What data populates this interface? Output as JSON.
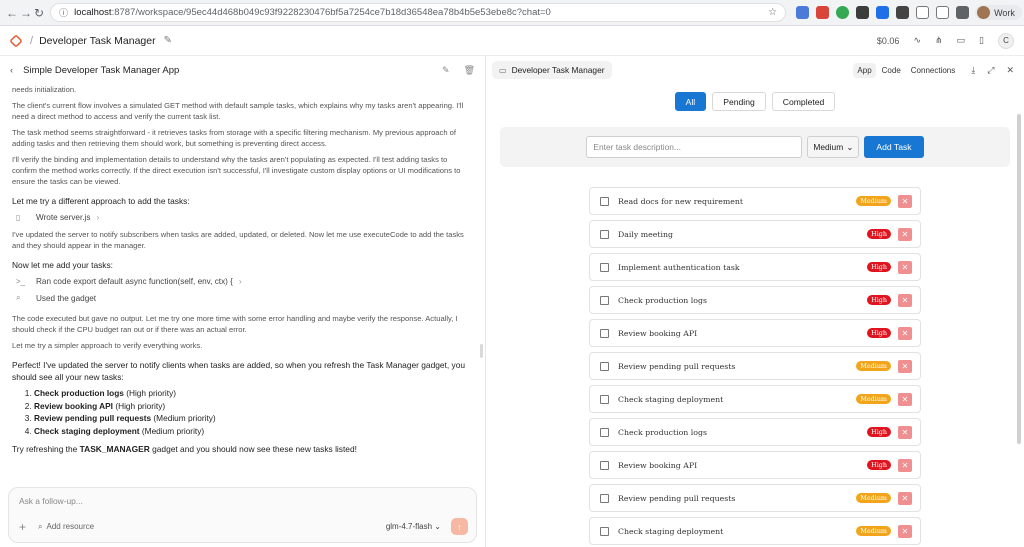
{
  "browser": {
    "url_host": "localhost",
    "url_rest": ":8787/workspace/95ec44d468b049c93f9228230476bf5a7254ce7b18d36548ea78b4b5e53ebe8c?chat=0",
    "profile": "Work"
  },
  "app": {
    "title": "Developer Task Manager",
    "cost": "$0.06",
    "user_initial": "C"
  },
  "chat": {
    "title": "Simple Developer Task Manager App",
    "messages": [
      "needs initialization.",
      "The client's current flow involves a simulated GET method with default sample tasks, which explains why my tasks aren't appearing. I'll need a direct method to access and verify the current task list.",
      "The task method seems straightforward - it retrieves tasks from storage with a specific filtering mechanism. My previous approach of adding tasks and then retrieving them should work, but something is preventing direct access.",
      "I'll verify the binding and implementation details to understand why the tasks aren't populating as expected. I'll test adding tasks to confirm the method works correctly. If the direct execution isn't successful, I'll investigate custom display options or UI modifications to ensure the tasks can be viewed."
    ],
    "heading1": "Let me try a different approach to add the tasks:",
    "tool1": "Wrote server.js",
    "msg2": "I've updated the server to notify subscribers when tasks are added, updated, or deleted. Now let me use executeCode to add the tasks and they should appear in the manager.",
    "heading2": "Now let me add your tasks:",
    "tool2": "Ran code export default async function(self, env, ctx) {",
    "tool3": "Used the gadget",
    "msg3": "The code executed but gave no output. Let me try one more time with some error handling and maybe verify the response. Actually, I should check if the CPU budget ran out or if there was an actual error.",
    "msg4": "Let me try a simpler approach to verify everything works.",
    "summary": "Perfect! I've updated the server to notify clients when tasks are added, so when you refresh the Task Manager gadget, you should see all your new tasks:",
    "list": [
      {
        "name": "Check production logs",
        "prio": "(High priority)"
      },
      {
        "name": "Review booking API",
        "prio": "(High priority)"
      },
      {
        "name": "Review pending pull requests",
        "prio": "(Medium priority)"
      },
      {
        "name": "Check staging deployment",
        "prio": "(Medium priority)"
      }
    ],
    "final_pre": "Try refreshing the ",
    "final_bold": "TASK_MANAGER",
    "final_post": " gadget and you should now see these new tasks listed!",
    "composer_placeholder": "Ask a follow-up...",
    "add_resource": "Add resource",
    "model": "glm-4.7-flash"
  },
  "gadget": {
    "tab_title": "Developer Task Manager",
    "modes": [
      "App",
      "Code",
      "Connections"
    ],
    "filters": [
      "All",
      "Pending",
      "Completed"
    ],
    "input_placeholder": "Enter task description...",
    "priority_selected": "Medium",
    "add_label": "Add Task",
    "tasks": [
      {
        "text": "Read docs for new requirement",
        "priority": "Medium"
      },
      {
        "text": "Daily meeting",
        "priority": "High"
      },
      {
        "text": "Implement authentication task",
        "priority": "High"
      },
      {
        "text": "Check production logs",
        "priority": "High"
      },
      {
        "text": "Review booking API",
        "priority": "High"
      },
      {
        "text": "Review pending pull requests",
        "priority": "Medium"
      },
      {
        "text": "Check staging deployment",
        "priority": "Medium"
      },
      {
        "text": "Check production logs",
        "priority": "High"
      },
      {
        "text": "Review booking API",
        "priority": "High"
      },
      {
        "text": "Review pending pull requests",
        "priority": "Medium"
      },
      {
        "text": "Check staging deployment",
        "priority": "Medium"
      }
    ]
  },
  "colors": {
    "accent": "#1877d2",
    "high": "#e0141e",
    "medium": "#f2a51a",
    "delete": "#ef8f8f"
  }
}
